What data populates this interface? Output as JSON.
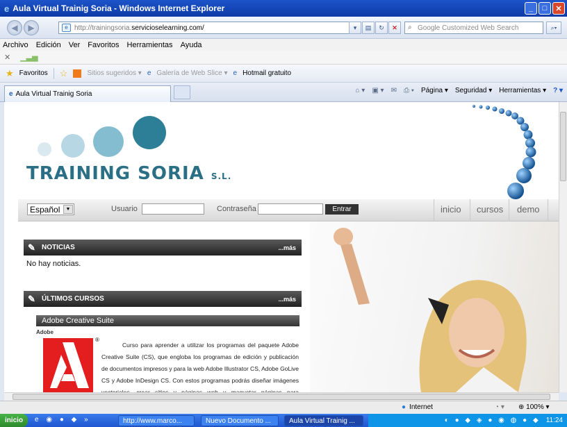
{
  "window": {
    "title": "Aula Virtual Trainig Soria - Windows Internet Explorer"
  },
  "address": {
    "prefix": "http://trainingsoria.",
    "domain": "servicioselearning.com/"
  },
  "search": {
    "placeholder": "Google Customized Web Search"
  },
  "menu": {
    "items": [
      "Archivo",
      "Edición",
      "Ver",
      "Favoritos",
      "Herramientas",
      "Ayuda"
    ]
  },
  "favorites": {
    "label": "Favoritos",
    "items": [
      "Sitios sugeridos ▾",
      "Galería de Web Slice ▾",
      "Hotmail gratuito"
    ]
  },
  "tab": {
    "title": "Aula Virtual Trainig Soria"
  },
  "commandbar": {
    "pagina": "Página ▾",
    "seguridad": "Seguridad ▾",
    "herramientas": "Herramientas ▾"
  },
  "page": {
    "brand": "TRAINING SORIA",
    "brand_suffix": "S.L.",
    "language": "Español",
    "login": {
      "user_label": "Usuario",
      "password_label": "Contraseña",
      "submit": "Entrar"
    },
    "nav": [
      "inicio",
      "cursos",
      "demo"
    ],
    "news": {
      "title": "NOTICIAS",
      "more": "...más",
      "empty": "No hay noticias."
    },
    "courses": {
      "title": "ÚLTIMOS CURSOS",
      "more": "...más",
      "course_title": "Adobe Creative Suite",
      "category": "Adobe",
      "description": "Curso para aprender a utilizar los programas del paquete Adobe Creative Suite (CS), que engloba los programas de edición y publicación de documentos impresos y para la web Adobe Illustrator CS, Adobe GoLive CS y Adobe InDesign CS. Con estos programas podrás diseñar imágenes vectoriales, crear sitios y páginas web y maquetar páginas para imprimirlas."
    }
  },
  "status": {
    "zone": "Internet",
    "zoom": "100%"
  },
  "taskbar": {
    "start": "inicio",
    "buttons": [
      "http://www.marco...",
      "Nuevo Documento ...",
      "Aula Virtual Trainig ..."
    ],
    "clock": "11:24"
  },
  "colors": {
    "brand": "#2a6f86",
    "ie_title": "#1d54c9",
    "adobe_red": "#e41e1e"
  }
}
